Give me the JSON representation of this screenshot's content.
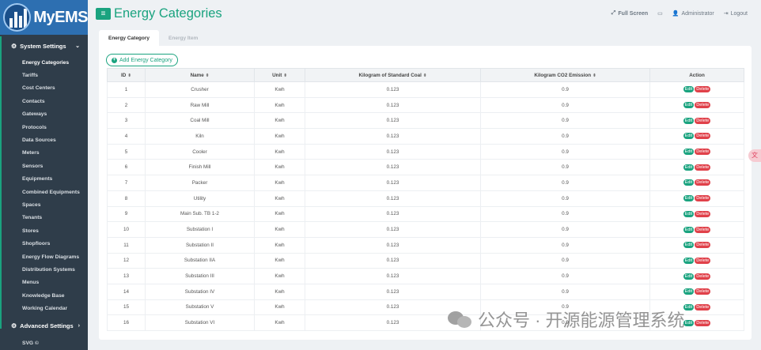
{
  "app": {
    "logo_text": "MyEMS",
    "page_title": "Energy Categories"
  },
  "header": {
    "fullscreen": "Full Screen",
    "user": "Administrator",
    "logout": "Logout"
  },
  "sidebar": {
    "section1": "System Settings",
    "items": [
      "Energy Categories",
      "Tariffs",
      "Cost Centers",
      "Contacts",
      "Gateways",
      "Protocols",
      "Data Sources",
      "Meters",
      "Sensors",
      "Equipments",
      "Combined Equipments",
      "Spaces",
      "Tenants",
      "Stores",
      "Shopfloors",
      "Energy Flow Diagrams",
      "Distribution Systems",
      "Menus",
      "Knowledge Base",
      "Working Calendar"
    ],
    "section2": "Advanced Settings",
    "extra": "SVG ©"
  },
  "tabs": [
    "Energy Category",
    "Energy Item"
  ],
  "add_button": "Add Energy Category",
  "table": {
    "headers": [
      "ID",
      "Name",
      "Unit",
      "Kilogram of Standard Coal",
      "Kilogram CO2 Emission",
      "Action"
    ],
    "edit_label": "Edit",
    "delete_label": "Delete",
    "rows": [
      {
        "id": "1",
        "name": "Crusher",
        "unit": "Kwh",
        "coal": "0.123",
        "co2": "0.9"
      },
      {
        "id": "2",
        "name": "Raw Mill",
        "unit": "Kwh",
        "coal": "0.123",
        "co2": "0.9"
      },
      {
        "id": "3",
        "name": "Coal Mill",
        "unit": "Kwh",
        "coal": "0.123",
        "co2": "0.9"
      },
      {
        "id": "4",
        "name": "Kiln",
        "unit": "Kwh",
        "coal": "0.123",
        "co2": "0.9"
      },
      {
        "id": "5",
        "name": "Cooler",
        "unit": "Kwh",
        "coal": "0.123",
        "co2": "0.9"
      },
      {
        "id": "6",
        "name": "Finish Mill",
        "unit": "Kwh",
        "coal": "0.123",
        "co2": "0.9"
      },
      {
        "id": "7",
        "name": "Packer",
        "unit": "Kwh",
        "coal": "0.123",
        "co2": "0.9"
      },
      {
        "id": "8",
        "name": "Utility",
        "unit": "Kwh",
        "coal": "0.123",
        "co2": "0.9"
      },
      {
        "id": "9",
        "name": "Main Sub. TB 1-2",
        "unit": "Kwh",
        "coal": "0.123",
        "co2": "0.9"
      },
      {
        "id": "10",
        "name": "Substation I",
        "unit": "Kwh",
        "coal": "0.123",
        "co2": "0.9"
      },
      {
        "id": "11",
        "name": "Substation II",
        "unit": "Kwh",
        "coal": "0.123",
        "co2": "0.9"
      },
      {
        "id": "12",
        "name": "Substation IIA",
        "unit": "Kwh",
        "coal": "0.123",
        "co2": "0.9"
      },
      {
        "id": "13",
        "name": "Substation III",
        "unit": "Kwh",
        "coal": "0.123",
        "co2": "0.9"
      },
      {
        "id": "14",
        "name": "Substation IV",
        "unit": "Kwh",
        "coal": "0.123",
        "co2": "0.9"
      },
      {
        "id": "15",
        "name": "Substation V",
        "unit": "Kwh",
        "coal": "0.123",
        "co2": "0.9"
      },
      {
        "id": "16",
        "name": "Substation VI",
        "unit": "Kwh",
        "coal": "0.123",
        "co2": "0.9"
      }
    ]
  },
  "float_tab": "文",
  "watermark": "公众号 · 开源能源管理系统",
  "colors": {
    "accent": "#1aa37f",
    "danger": "#e0414a",
    "sidebar": "#2f3d4a",
    "logo_bg": "#2d6fb1"
  }
}
